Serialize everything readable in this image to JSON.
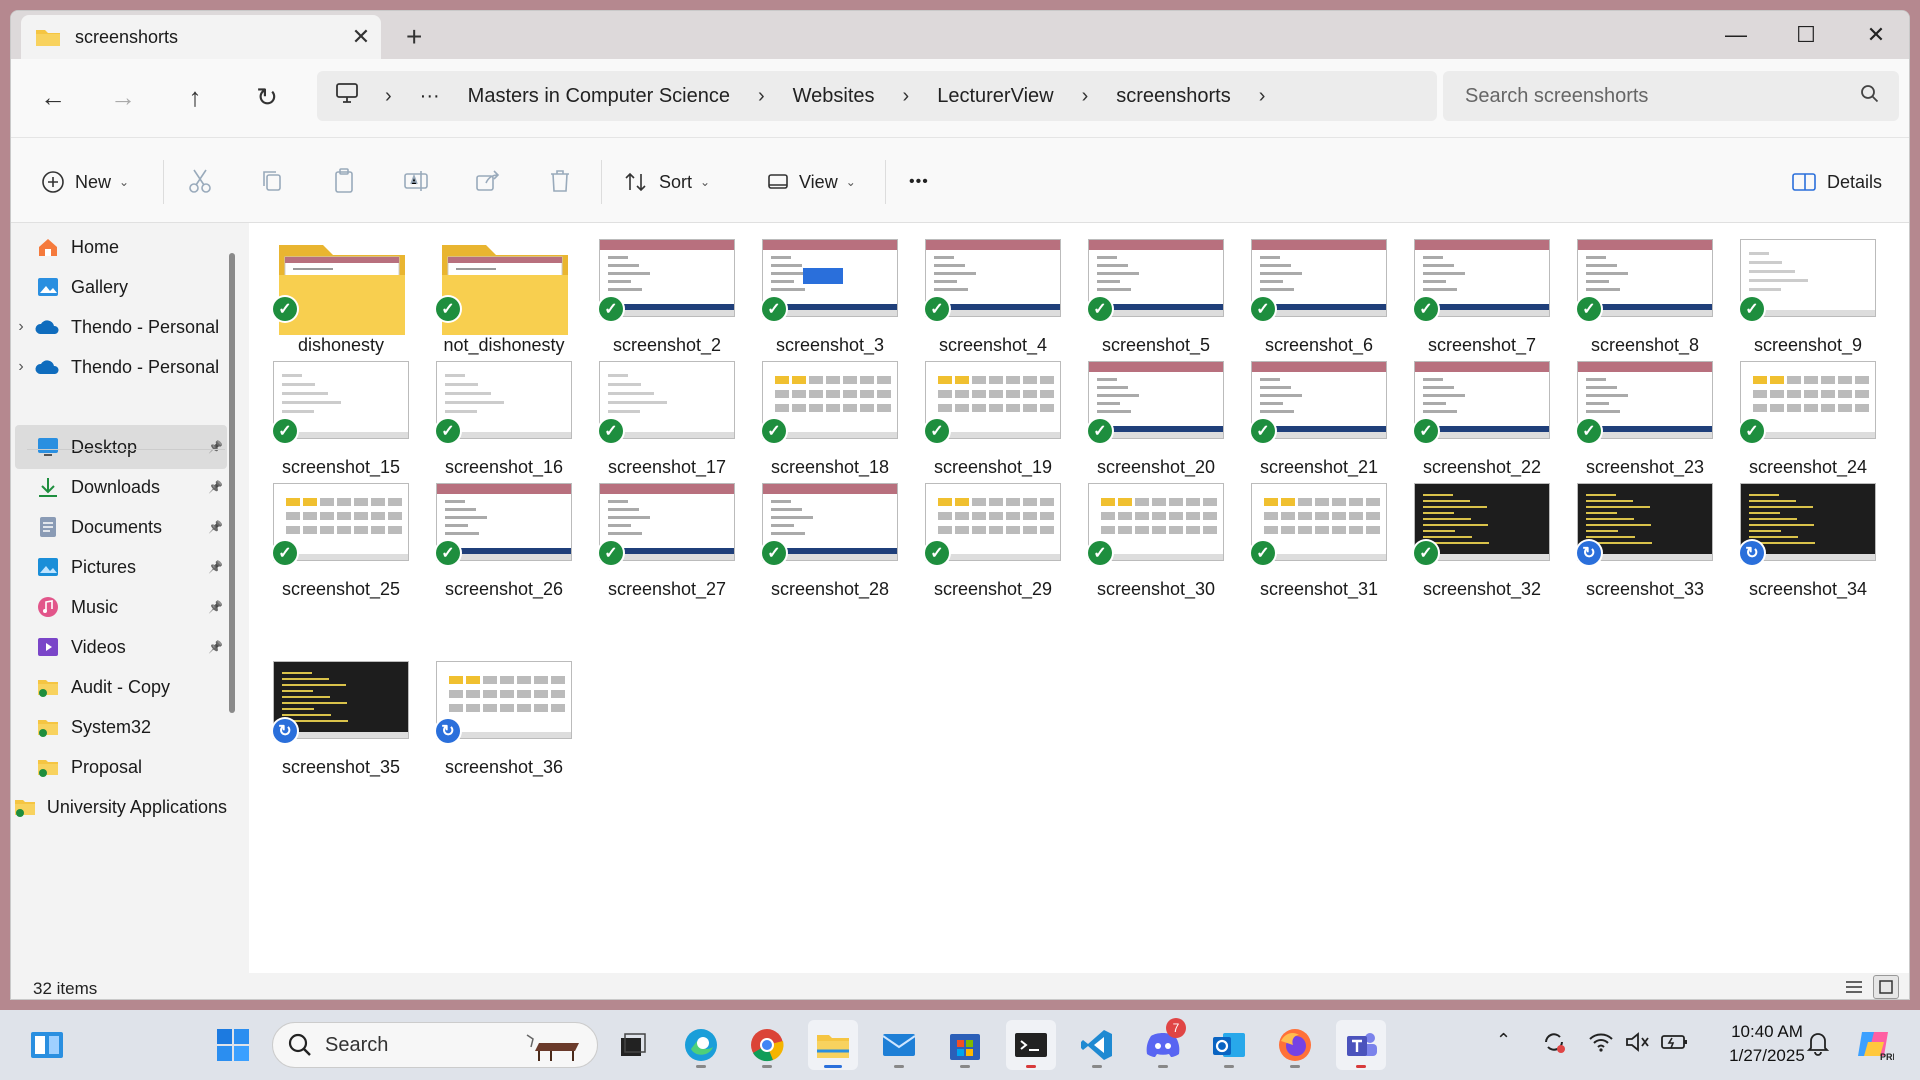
{
  "window": {
    "tab_title": "screenshorts",
    "close_tab": "✕",
    "new_tab": "+",
    "minimize": "—",
    "maximize": "☐",
    "close": "✕"
  },
  "address": {
    "crumbs": [
      "Masters in Computer Science",
      "Websites",
      "LecturerView",
      "screenshorts"
    ],
    "more": "···",
    "search_placeholder": "Search screenshorts"
  },
  "toolbar": {
    "new_label": "New",
    "sort_label": "Sort",
    "view_label": "View",
    "more_label": "•••",
    "details_label": "Details"
  },
  "sidebar": {
    "items": [
      {
        "label": "Home",
        "icon": "home-icon",
        "expand": false,
        "pin": false
      },
      {
        "label": "Gallery",
        "icon": "gallery-icon",
        "expand": false,
        "pin": false
      },
      {
        "label": "Thendo - Personal",
        "icon": "onedrive-icon",
        "expand": true,
        "pin": false
      },
      {
        "label": "Thendo - Personal",
        "icon": "onedrive-icon",
        "expand": true,
        "pin": false
      },
      {
        "label": "Desktop",
        "icon": "desktop-icon",
        "expand": false,
        "pin": true,
        "selected": true
      },
      {
        "label": "Downloads",
        "icon": "downloads-icon",
        "expand": false,
        "pin": true
      },
      {
        "label": "Documents",
        "icon": "documents-icon",
        "expand": false,
        "pin": true
      },
      {
        "label": "Pictures",
        "icon": "pictures-icon",
        "expand": false,
        "pin": true
      },
      {
        "label": "Music",
        "icon": "music-icon",
        "expand": false,
        "pin": true
      },
      {
        "label": "Videos",
        "icon": "videos-icon",
        "expand": false,
        "pin": true
      },
      {
        "label": "Audit - Copy",
        "icon": "folder-icon",
        "expand": false,
        "pin": false
      },
      {
        "label": "System32",
        "icon": "folder-icon",
        "expand": false,
        "pin": false
      },
      {
        "label": "Proposal",
        "icon": "folder-icon",
        "expand": false,
        "pin": false
      },
      {
        "label": "University Applications",
        "icon": "folder-icon",
        "expand": false,
        "pin": false
      }
    ]
  },
  "files": [
    {
      "name": "dishonesty",
      "kind": "folder",
      "status": "synced"
    },
    {
      "name": "not_dishonesty",
      "kind": "folder",
      "status": "synced"
    },
    {
      "name": "screenshot_2",
      "kind": "form",
      "status": "synced"
    },
    {
      "name": "screenshot_3",
      "kind": "login",
      "status": "synced"
    },
    {
      "name": "screenshot_4",
      "kind": "form",
      "status": "synced"
    },
    {
      "name": "screenshot_5",
      "kind": "form",
      "status": "synced"
    },
    {
      "name": "screenshot_6",
      "kind": "form",
      "status": "synced"
    },
    {
      "name": "screenshot_7",
      "kind": "form",
      "status": "synced"
    },
    {
      "name": "screenshot_8",
      "kind": "form",
      "status": "synced"
    },
    {
      "name": "screenshot_9",
      "kind": "plain",
      "status": "synced"
    },
    {
      "name": "screenshot_15",
      "kind": "plain",
      "status": "synced"
    },
    {
      "name": "screenshot_16",
      "kind": "plain",
      "status": "synced"
    },
    {
      "name": "screenshot_17",
      "kind": "plain",
      "status": "synced"
    },
    {
      "name": "screenshot_18",
      "kind": "grid",
      "status": "synced"
    },
    {
      "name": "screenshot_19",
      "kind": "grid",
      "status": "synced"
    },
    {
      "name": "screenshot_20",
      "kind": "form",
      "status": "synced"
    },
    {
      "name": "screenshot_21",
      "kind": "form",
      "status": "synced"
    },
    {
      "name": "screenshot_22",
      "kind": "form",
      "status": "synced"
    },
    {
      "name": "screenshot_23",
      "kind": "form",
      "status": "synced"
    },
    {
      "name": "screenshot_24",
      "kind": "grid",
      "status": "synced"
    },
    {
      "name": "screenshot_25",
      "kind": "grid",
      "status": "synced"
    },
    {
      "name": "screenshot_26",
      "kind": "form",
      "status": "synced"
    },
    {
      "name": "screenshot_27",
      "kind": "form",
      "status": "synced"
    },
    {
      "name": "screenshot_28",
      "kind": "form",
      "status": "synced"
    },
    {
      "name": "screenshot_29",
      "kind": "grid",
      "status": "synced"
    },
    {
      "name": "screenshot_30",
      "kind": "grid",
      "status": "synced"
    },
    {
      "name": "screenshot_31",
      "kind": "grid",
      "status": "synced"
    },
    {
      "name": "screenshot_32",
      "kind": "dark",
      "status": "synced"
    },
    {
      "name": "screenshot_33",
      "kind": "dark",
      "status": "syncing"
    },
    {
      "name": "screenshot_34",
      "kind": "dark",
      "status": "syncing"
    },
    {
      "name": "screenshot_35",
      "kind": "dark",
      "status": "syncing"
    },
    {
      "name": "screenshot_36",
      "kind": "grid",
      "status": "syncing"
    }
  ],
  "status_bar": {
    "count": "32 items"
  },
  "taskbar": {
    "search_placeholder": "Search",
    "discord_badge": "7",
    "time": "10:40 AM",
    "date": "1/27/2025"
  },
  "colors": {
    "synced": "#1e8e3e",
    "syncing": "#2a6fdb",
    "folder": "#f5c542",
    "accent": "#b8707e"
  }
}
